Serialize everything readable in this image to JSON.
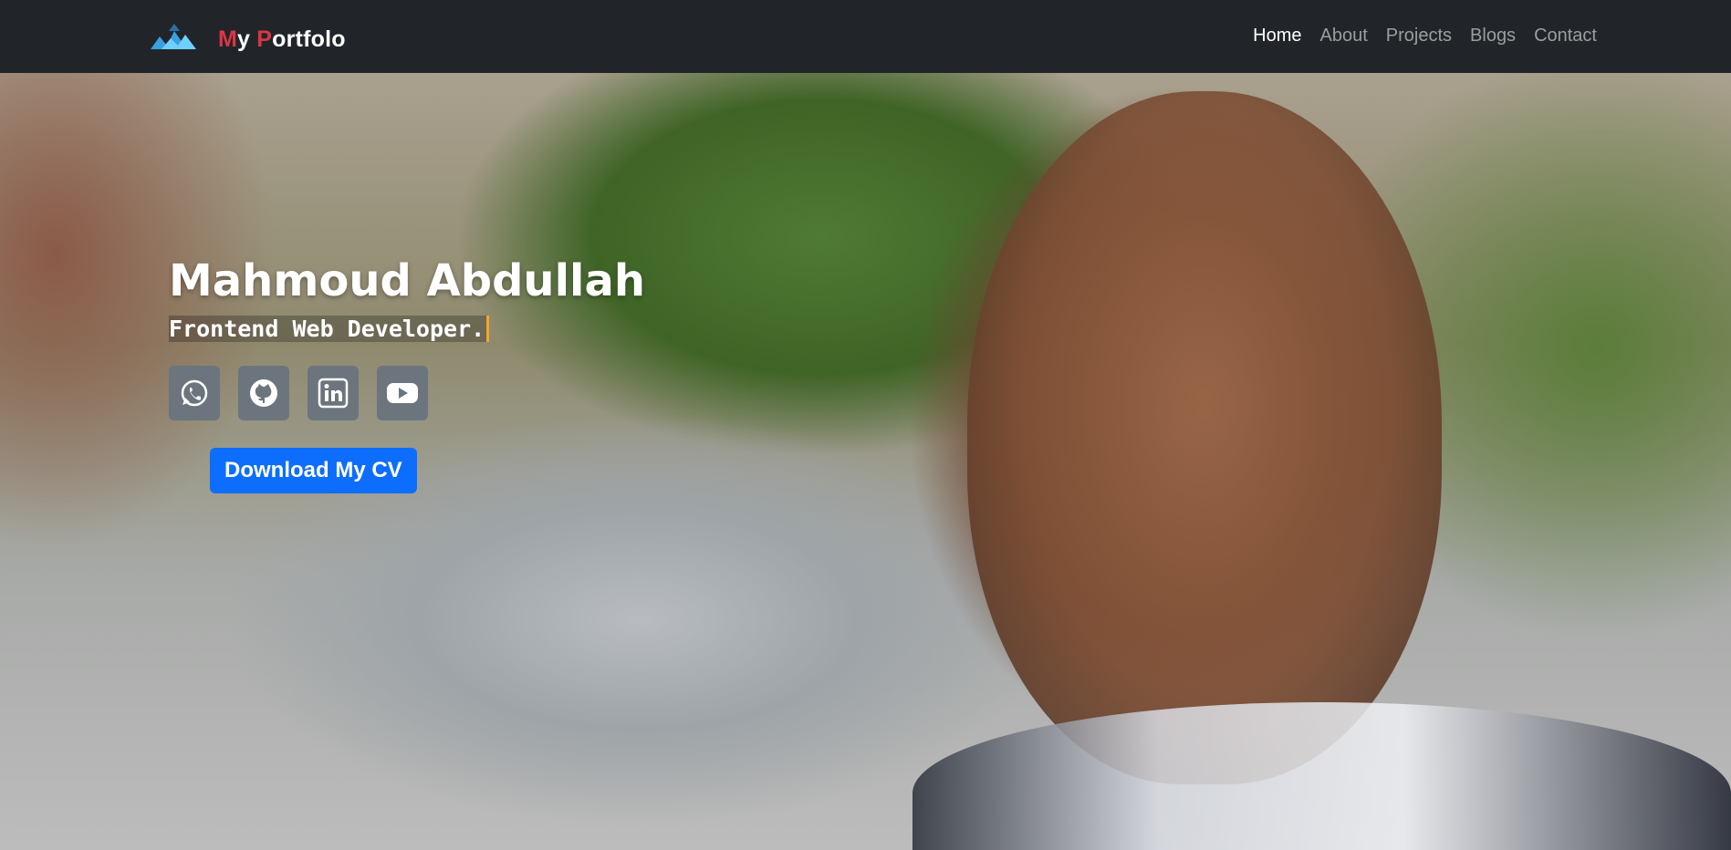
{
  "navbar": {
    "brand": {
      "first": "M",
      "part1": "y ",
      "second": "P",
      "part2": "ortfolo"
    },
    "links": [
      {
        "label": "Home",
        "active": true
      },
      {
        "label": "About"
      },
      {
        "label": "Projects"
      },
      {
        "label": "Blogs"
      },
      {
        "label": "Contact"
      }
    ]
  },
  "hero": {
    "name": "Mahmoud Abdullah",
    "role": "Frontend Web Developer.",
    "socials": [
      {
        "icon": "whatsapp-icon"
      },
      {
        "icon": "github-icon"
      },
      {
        "icon": "linkedin-icon"
      },
      {
        "icon": "youtube-icon"
      }
    ],
    "cv_button": "Download My CV"
  },
  "colors": {
    "navbar_bg": "#212529",
    "brand_accent": "#dc3545",
    "cv_button": "#0d6efd",
    "social_bg": "#6c757d",
    "cursor": "#f5a623"
  }
}
